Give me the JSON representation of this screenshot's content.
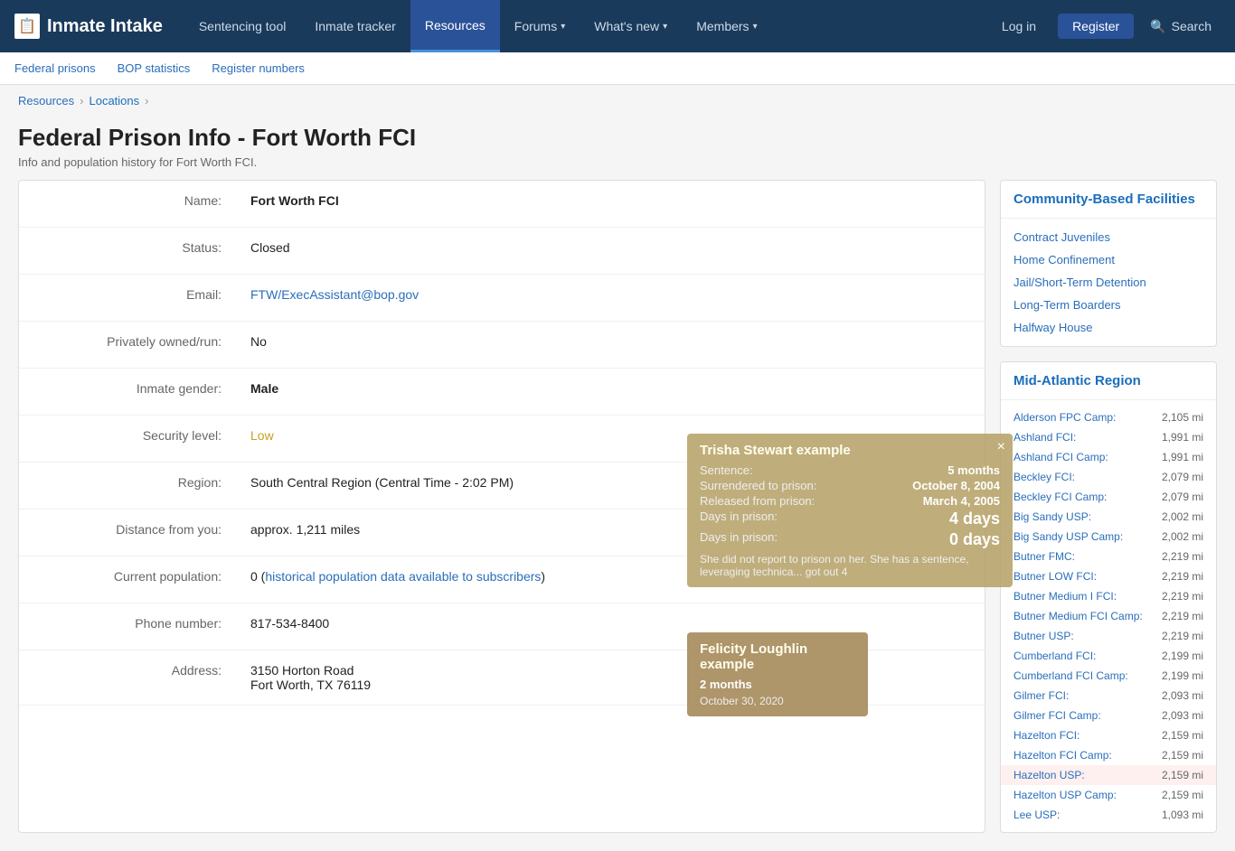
{
  "app": {
    "logo_icon": "📋",
    "logo_text": "Inmate Intake"
  },
  "top_nav": {
    "items": [
      {
        "label": "Sentencing tool",
        "active": false
      },
      {
        "label": "Inmate tracker",
        "active": false
      },
      {
        "label": "Resources",
        "active": true
      },
      {
        "label": "Forums",
        "has_arrow": true,
        "active": false
      },
      {
        "label": "What's new",
        "has_arrow": true,
        "active": false
      },
      {
        "label": "Members",
        "has_arrow": true,
        "active": false
      }
    ],
    "login_label": "Log in",
    "register_label": "Register",
    "search_label": "Search"
  },
  "sub_nav": {
    "items": [
      {
        "label": "Federal prisons"
      },
      {
        "label": "BOP statistics"
      },
      {
        "label": "Register numbers"
      }
    ]
  },
  "breadcrumb": {
    "items": [
      {
        "label": "Resources",
        "link": true
      },
      {
        "label": "Locations",
        "link": true,
        "current": true
      }
    ]
  },
  "page": {
    "title": "Federal Prison Info - Fort Worth FCI",
    "subtitle": "Info and population history for Fort Worth FCI."
  },
  "prison_info": {
    "fields": [
      {
        "label": "Name:",
        "value": "Fort Worth FCI",
        "bold": true
      },
      {
        "label": "Status:",
        "value": "Closed",
        "bold": false
      },
      {
        "label": "Email:",
        "value": "FTW/ExecAssistant@bop.gov",
        "link": true
      },
      {
        "label": "Privately owned/run:",
        "value": "No",
        "bold": false
      },
      {
        "label": "Inmate gender:",
        "value": "Male",
        "bold": true
      },
      {
        "label": "Security level:",
        "value": "Low",
        "special": "low"
      },
      {
        "label": "Region:",
        "value": "South Central Region (Central Time - 2:02 PM)",
        "bold": false
      },
      {
        "label": "Distance from you:",
        "value": "approx. 1,211 miles",
        "bold": false
      },
      {
        "label": "Current population:",
        "value_pre": "0 (",
        "value_link": "historical population data available to subscribers",
        "value_post": ")",
        "bold": false
      },
      {
        "label": "Phone number:",
        "value": "817-534-8400",
        "bold": false
      },
      {
        "label": "Address:",
        "value": "3150 Horton Road\nFort Worth, TX 76119",
        "bold": false
      }
    ]
  },
  "sidebar": {
    "community": {
      "title": "Community-Based Facilities",
      "links": [
        "Contract Juveniles",
        "Home Confinement",
        "Jail/Short-Term Detention",
        "Long-Term Boarders",
        "Halfway House"
      ]
    },
    "mid_atlantic": {
      "title": "Mid-Atlantic Region",
      "rows": [
        {
          "name": "Alderson FPC Camp:",
          "dist": "2,105 mi"
        },
        {
          "name": "Ashland FCI:",
          "dist": "1,991 mi"
        },
        {
          "name": "Ashland FCI Camp:",
          "dist": "1,991 mi"
        },
        {
          "name": "Beckley FCI:",
          "dist": "2,079 mi"
        },
        {
          "name": "Beckley FCI Camp:",
          "dist": "2,079 mi"
        },
        {
          "name": "Big Sandy USP:",
          "dist": "2,002 mi"
        },
        {
          "name": "Big Sandy USP Camp:",
          "dist": "2,002 mi"
        },
        {
          "name": "Butner FMC:",
          "dist": "2,219 mi"
        },
        {
          "name": "Butner LOW FCI:",
          "dist": "2,219 mi"
        },
        {
          "name": "Butner Medium I FCI:",
          "dist": "2,219 mi"
        },
        {
          "name": "Butner Medium FCI Camp:",
          "dist": "2,219 mi"
        },
        {
          "name": "Butner USP:",
          "dist": "2,219 mi"
        },
        {
          "name": "Cumberland FCI:",
          "dist": "2,199 mi"
        },
        {
          "name": "Cumberland FCI Camp:",
          "dist": "2,199 mi"
        },
        {
          "name": "Gilmer FCI:",
          "dist": "2,093 mi"
        },
        {
          "name": "Gilmer FCI Camp:",
          "dist": "2,093 mi"
        },
        {
          "name": "Hazelton FCI:",
          "dist": "2,159 mi"
        },
        {
          "name": "Hazelton FCI Camp:",
          "dist": "2,159 mi"
        },
        {
          "name": "Hazelton USP:",
          "dist": "2,159 mi",
          "highlight": true
        },
        {
          "name": "Hazelton USP Camp:",
          "dist": "2,159 mi"
        },
        {
          "name": "Lee USP:",
          "dist": "1,093 mi"
        }
      ]
    }
  },
  "popup": {
    "title": "Trisha Stewart example",
    "close": "×",
    "rows": [
      {
        "label": "Sentence:",
        "value": "5 months"
      },
      {
        "label": "Surrendered to prison:",
        "value": "October 8, 2004"
      },
      {
        "label": "Released from prison:",
        "value": "March 4, 2005"
      },
      {
        "label": "Days in prison:",
        "value": "4 days"
      },
      {
        "label": "Days in prison:",
        "value": "0 days"
      }
    ],
    "text": "She did not report to prison on her. She has a sentence, leveraging technica... got out 4"
  },
  "popup2": {
    "title": "Felicity Loughlin example",
    "duration": "2 months",
    "date": "October 30, 2020"
  }
}
